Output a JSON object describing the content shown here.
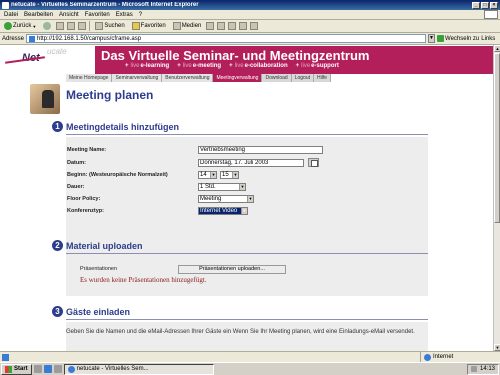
{
  "window": {
    "title": "netucate - Virtuelles Seminarzentrum - Microsoft Internet Explorer"
  },
  "menu": [
    "Datei",
    "Bearbeiten",
    "Ansicht",
    "Favoriten",
    "Extras",
    "?"
  ],
  "toolbar": {
    "back": "Zurück",
    "search": "Suchen",
    "favorites": "Favoriten",
    "media": "Medien"
  },
  "address": {
    "label": "Adresse",
    "url": "http://192.168.1.50/campus/cframe.asp",
    "go": "Wechseln zu",
    "links": "Links"
  },
  "banner": {
    "logo_prefix": "ucate",
    "logo_main": "Net",
    "title": "Das Virtuelle Seminar- und Meetingzentrum",
    "tags": [
      {
        "pre": "live",
        "label": "e-learning"
      },
      {
        "pre": "live",
        "label": "e-meeting"
      },
      {
        "pre": "live",
        "label": "e-collaboration"
      },
      {
        "pre": "live",
        "label": "e-support"
      }
    ]
  },
  "nav": [
    "Meine Homepage",
    "Seminarverwaltung",
    "Benutzerverwaltung",
    "Meetingverwaltung",
    "Download",
    "Logout",
    "Hilfe"
  ],
  "page": {
    "title": "Meeting planen"
  },
  "section1": {
    "number": "1",
    "title": "Meetingdetails hinzufügen",
    "fields": {
      "name_label": "Meeting Name:",
      "name_value": "Vertriebsmeeting",
      "date_label": "Datum:",
      "date_value": "Donnerstag, 17. Juli 2003",
      "begin_label": "Beginn: (Westeuropäische Normalzeit)",
      "begin_hour": "14",
      "begin_min": "15",
      "duration_label": "Dauer:",
      "duration_value": "1 Std.",
      "floor_label": "Floor Policy:",
      "floor_value": "Meeting",
      "conf_label": "Konferenztyp:",
      "conf_value": "Internet Video"
    }
  },
  "section2": {
    "number": "2",
    "title": "Material uploaden",
    "pres_label": "Präsentationen",
    "upload_button": "Präsentationen uploaden...",
    "error": "Es wurden keine Präsentationen hinzugefügt."
  },
  "section3": {
    "number": "3",
    "title": "Gäste einladen",
    "text": "Geben Sie die Namen und die eMail-Adressen Ihrer Gäste ein Wenn Sie Ihr Meeting planen, wird eine Einladungs-eMail versendet."
  },
  "status": {
    "zone": "Internet"
  },
  "taskbar": {
    "start": "Start",
    "task": "netucate - Virtuelles Sem...",
    "clock": "14:13"
  }
}
